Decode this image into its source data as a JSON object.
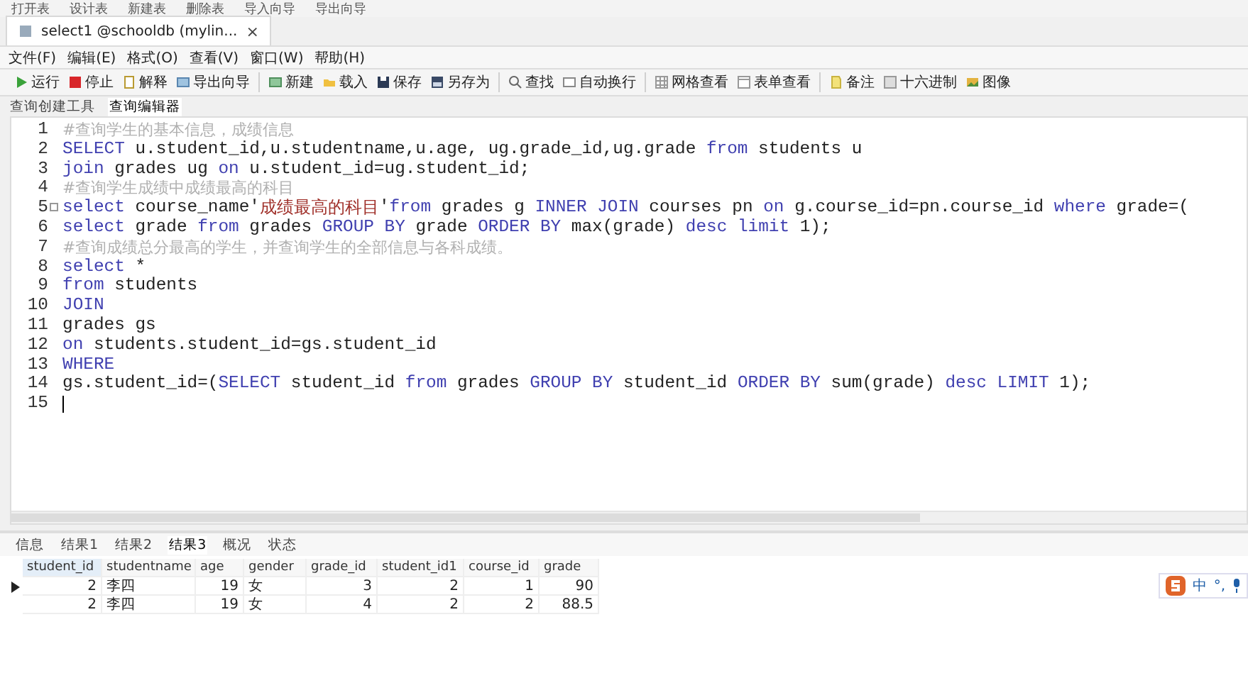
{
  "top_toolbar": [
    "打开表",
    "设计表",
    "新建表",
    "删除表",
    "导入向导",
    "导出向导"
  ],
  "document_tab": {
    "title": "select1 @schooldb (mylin...",
    "close": "×",
    "selected": true
  },
  "menu": [
    "文件(F)",
    "编辑(E)",
    "格式(O)",
    "查看(V)",
    "窗口(W)",
    "帮助(H)"
  ],
  "toolbar": {
    "groups": [
      [
        "运行",
        "停止",
        "解释",
        "导出向导"
      ],
      [
        "新建",
        "载入",
        "保存",
        "另存为"
      ],
      [
        "查找",
        "自动换行"
      ],
      [
        "网格查看",
        "表单查看"
      ],
      [
        "备注",
        "十六进制",
        "图像"
      ]
    ]
  },
  "sub_tabs": [
    {
      "label": "查询创建工具",
      "selected": false
    },
    {
      "label": "查询编辑器",
      "selected": true
    }
  ],
  "editor": {
    "lines": [
      {
        "number": "1",
        "segments": [
          {
            "kind": "comment",
            "text": "#查询学生的基本信息，成绩信息"
          }
        ]
      },
      {
        "number": "2",
        "segments": [
          {
            "kind": "keyword",
            "text": "SELECT"
          },
          {
            "kind": "plain",
            "text": " u.student_id,u.studentname,u.age, ug.grade_id,ug.grade "
          },
          {
            "kind": "keyword",
            "text": "from"
          },
          {
            "kind": "plain",
            "text": " students u"
          }
        ]
      },
      {
        "number": "3",
        "segments": [
          {
            "kind": "keyword",
            "text": "join"
          },
          {
            "kind": "plain",
            "text": " grades ug "
          },
          {
            "kind": "keyword",
            "text": "on"
          },
          {
            "kind": "plain",
            "text": " u.student_id=ug.student_id;"
          }
        ]
      },
      {
        "number": "4",
        "segments": [
          {
            "kind": "comment",
            "text": "#查询学生成绩中成绩最高的科目"
          }
        ]
      },
      {
        "number": "5",
        "folded": false,
        "segments": [
          {
            "kind": "keyword",
            "text": "select"
          },
          {
            "kind": "plain",
            "text": " course_name'"
          },
          {
            "kind": "string",
            "text": "成绩最高的科目"
          },
          {
            "kind": "plain",
            "text": "'"
          },
          {
            "kind": "keyword",
            "text": "from"
          },
          {
            "kind": "plain",
            "text": " grades g "
          },
          {
            "kind": "keyword",
            "text": "INNER JOIN"
          },
          {
            "kind": "plain",
            "text": " courses pn "
          },
          {
            "kind": "keyword",
            "text": "on"
          },
          {
            "kind": "plain",
            "text": " g.course_id=pn.course_id "
          },
          {
            "kind": "keyword",
            "text": "where"
          },
          {
            "kind": "plain",
            "text": " grade=("
          }
        ]
      },
      {
        "number": "6",
        "segments": [
          {
            "kind": "keyword",
            "text": "select"
          },
          {
            "kind": "plain",
            "text": " grade "
          },
          {
            "kind": "keyword",
            "text": "from"
          },
          {
            "kind": "plain",
            "text": " grades "
          },
          {
            "kind": "keyword",
            "text": "GROUP BY"
          },
          {
            "kind": "plain",
            "text": " grade "
          },
          {
            "kind": "keyword",
            "text": "ORDER BY"
          },
          {
            "kind": "plain",
            "text": " max(grade) "
          },
          {
            "kind": "keyword",
            "text": "desc limit"
          },
          {
            "kind": "plain",
            "text": " 1);"
          }
        ]
      },
      {
        "number": "7",
        "segments": [
          {
            "kind": "comment",
            "text": "#查询成绩总分最高的学生，并查询学生的全部信息与各科成绩。"
          }
        ]
      },
      {
        "number": "8",
        "segments": [
          {
            "kind": "keyword",
            "text": "select"
          },
          {
            "kind": "plain",
            "text": " *"
          }
        ]
      },
      {
        "number": "9",
        "segments": [
          {
            "kind": "keyword",
            "text": "from"
          },
          {
            "kind": "plain",
            "text": " students"
          }
        ]
      },
      {
        "number": "10",
        "segments": [
          {
            "kind": "keyword",
            "text": "JOIN"
          }
        ]
      },
      {
        "number": "11",
        "segments": [
          {
            "kind": "plain",
            "text": "grades gs"
          }
        ]
      },
      {
        "number": "12",
        "segments": [
          {
            "kind": "keyword",
            "text": "on"
          },
          {
            "kind": "plain",
            "text": " students.student_id=gs.student_id"
          }
        ]
      },
      {
        "number": "13",
        "segments": [
          {
            "kind": "keyword",
            "text": "WHERE"
          }
        ]
      },
      {
        "number": "14",
        "segments": [
          {
            "kind": "plain",
            "text": "gs.student_id=("
          },
          {
            "kind": "keyword",
            "text": "SELECT"
          },
          {
            "kind": "plain",
            "text": " student_id "
          },
          {
            "kind": "keyword",
            "text": "from"
          },
          {
            "kind": "plain",
            "text": " grades "
          },
          {
            "kind": "keyword",
            "text": "GROUP BY"
          },
          {
            "kind": "plain",
            "text": " student_id "
          },
          {
            "kind": "keyword",
            "text": "ORDER BY"
          },
          {
            "kind": "plain",
            "text": " sum(grade) "
          },
          {
            "kind": "keyword",
            "text": "desc LIMIT"
          },
          {
            "kind": "plain",
            "text": " 1);"
          }
        ]
      },
      {
        "number": "15",
        "cursor": true
      }
    ]
  },
  "result_tabs": [
    {
      "label": "信息",
      "selected": false
    },
    {
      "label": "结果1",
      "selected": false
    },
    {
      "label": "结果2",
      "selected": false
    },
    {
      "label": "结果3",
      "selected": true
    },
    {
      "label": "概况",
      "selected": false
    },
    {
      "label": "状态",
      "selected": false
    }
  ],
  "result_table": {
    "columns": [
      "student_id",
      "studentname",
      "age",
      "gender",
      "grade_id",
      "student_id1",
      "course_id",
      "grade"
    ],
    "rows": [
      {
        "selected": true,
        "cells": [
          "2",
          "李四",
          "19",
          "女",
          "3",
          "2",
          "1",
          "90"
        ]
      },
      {
        "selected": false,
        "cells": [
          "2",
          "李四",
          "19",
          "女",
          "4",
          "2",
          "2",
          "88.5"
        ]
      }
    ]
  },
  "ime_bar": {
    "mode": "中",
    "punct": "°,"
  }
}
